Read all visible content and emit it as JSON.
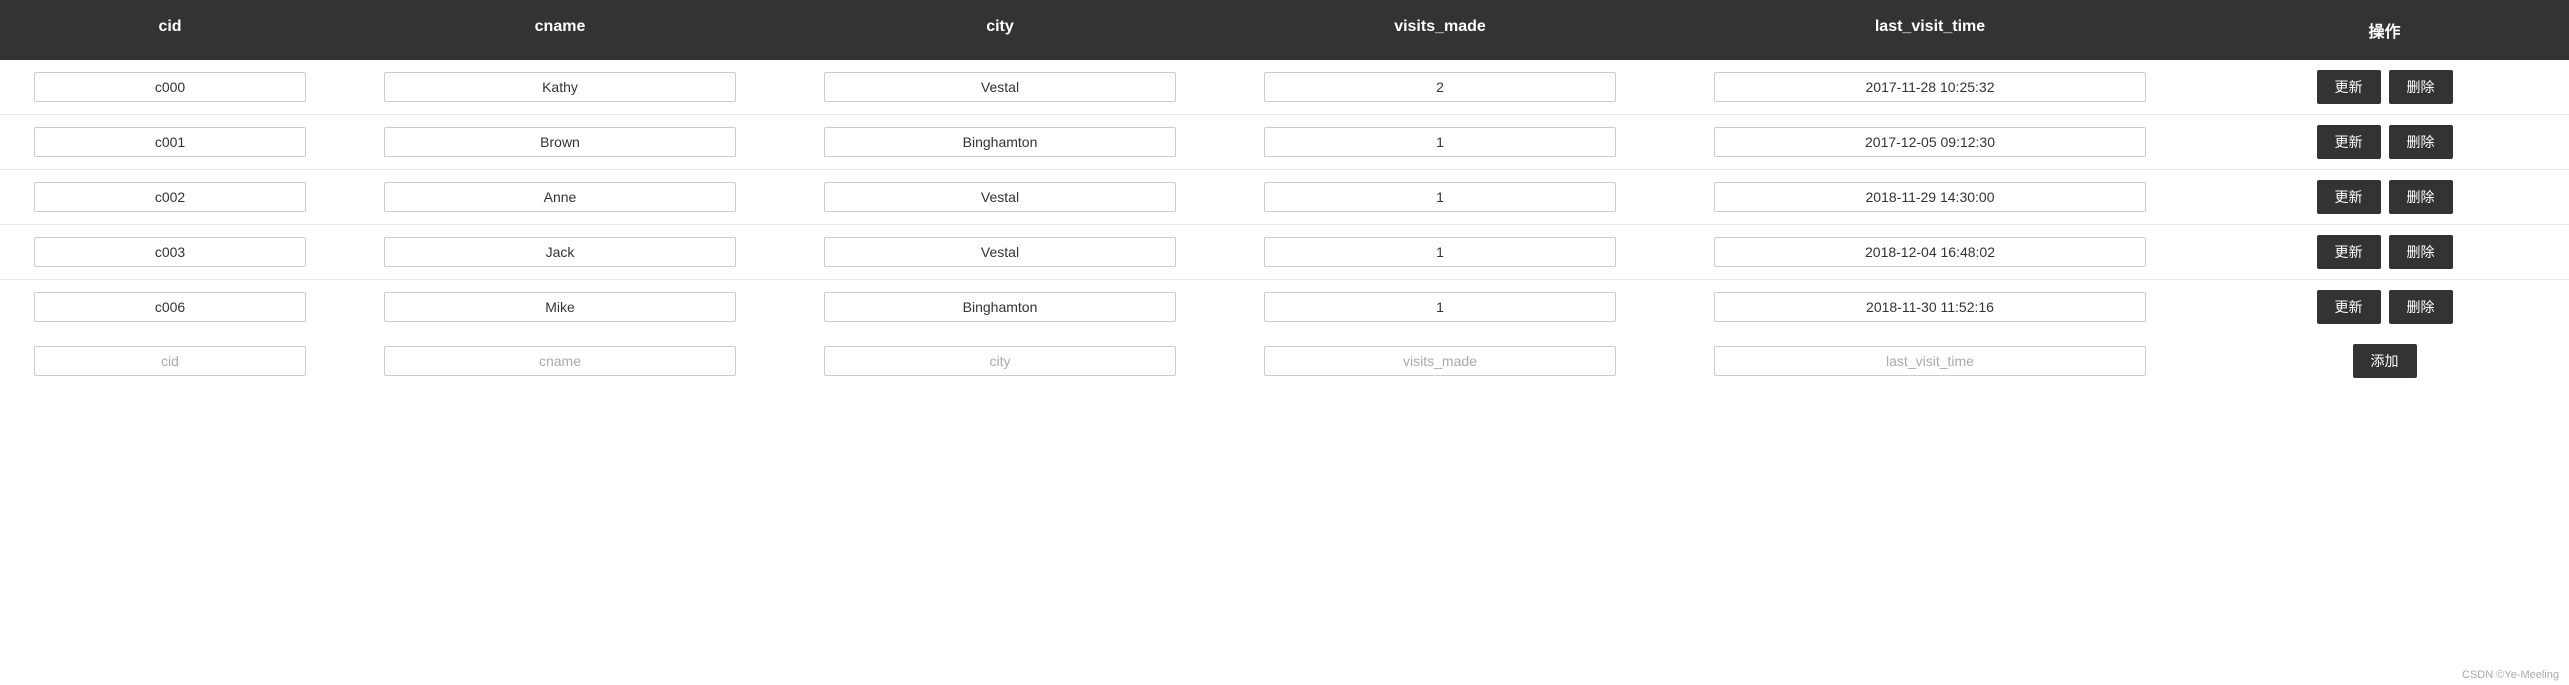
{
  "header": {
    "col_cid": "cid",
    "col_cname": "cname",
    "col_city": "city",
    "col_visits": "visits_made",
    "col_lastvisit": "last_visit_time",
    "col_ops": "操作"
  },
  "rows": [
    {
      "cid": "c000",
      "cname": "Kathy",
      "city": "Vestal",
      "visits": "2",
      "last_visit": "2017-11-28 10:25:32"
    },
    {
      "cid": "c001",
      "cname": "Brown",
      "city": "Binghamton",
      "visits": "1",
      "last_visit": "2017-12-05 09:12:30"
    },
    {
      "cid": "c002",
      "cname": "Anne",
      "city": "Vestal",
      "visits": "1",
      "last_visit": "2018-11-29 14:30:00"
    },
    {
      "cid": "c003",
      "cname": "Jack",
      "city": "Vestal",
      "visits": "1",
      "last_visit": "2018-12-04 16:48:02"
    },
    {
      "cid": "c006",
      "cname": "Mike",
      "city": "Binghamton",
      "visits": "1",
      "last_visit": "2018-11-30 11:52:16"
    }
  ],
  "add_row": {
    "cid_placeholder": "cid",
    "cname_placeholder": "cname",
    "city_placeholder": "city",
    "visits_placeholder": "visits_made",
    "lastvisit_placeholder": "last_visit_time",
    "btn_add": "添加"
  },
  "buttons": {
    "update": "更新",
    "delete": "删除"
  },
  "footer": "CSDN ©Ye-Meeling"
}
